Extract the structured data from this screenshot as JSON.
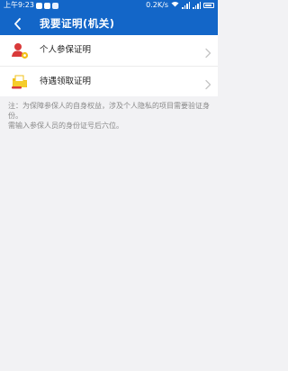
{
  "status": {
    "time": "上午9:23",
    "network_speed": "0.2K/s"
  },
  "header": {
    "title": "我要证明(机关)"
  },
  "menu": {
    "items": [
      {
        "label": "个人参保证明",
        "icon": "person-badge-icon"
      },
      {
        "label": "待遇领取证明",
        "icon": "document-folder-icon"
      }
    ]
  },
  "note": {
    "line1": "注：为保障参保人的自身权益，涉及个人隐私的项目需要验证身份。",
    "line2": "需输入参保人员的身份证号后六位。"
  },
  "colors": {
    "header_bg": "#1366c8",
    "page_bg": "#f2f2f4",
    "icon_red": "#d93a3a",
    "icon_yellow": "#f2c018"
  }
}
